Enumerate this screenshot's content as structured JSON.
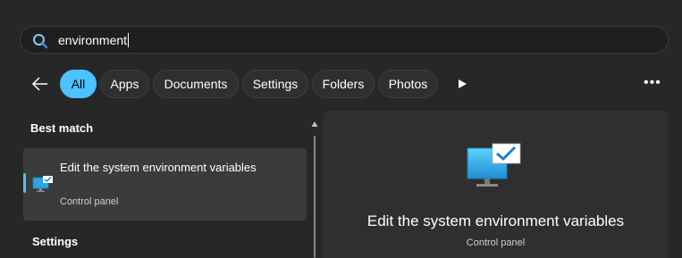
{
  "search": {
    "query": "environment",
    "icon": "search-icon"
  },
  "filters": {
    "back_icon": "back-arrow-icon",
    "chips": [
      {
        "label": "All",
        "active": true
      },
      {
        "label": "Apps",
        "active": false
      },
      {
        "label": "Documents",
        "active": false
      },
      {
        "label": "Settings",
        "active": false
      },
      {
        "label": "Folders",
        "active": false
      },
      {
        "label": "Photos",
        "active": false
      }
    ],
    "play_icon": "play-icon",
    "more_icon": "more-options-icon"
  },
  "results": {
    "best_match_heading": "Best match",
    "best_match": {
      "title": "Edit the system environment variables",
      "subtitle": "Control panel",
      "icon": "system-properties-icon"
    },
    "settings_heading": "Settings"
  },
  "preview": {
    "title": "Edit the system environment variables",
    "subtitle": "Control panel",
    "icon": "system-properties-icon"
  },
  "colors": {
    "accent": "#4cc2ff",
    "background": "#272727",
    "panel": "#2f2f2f",
    "selected_row": "#3b3b3b"
  }
}
